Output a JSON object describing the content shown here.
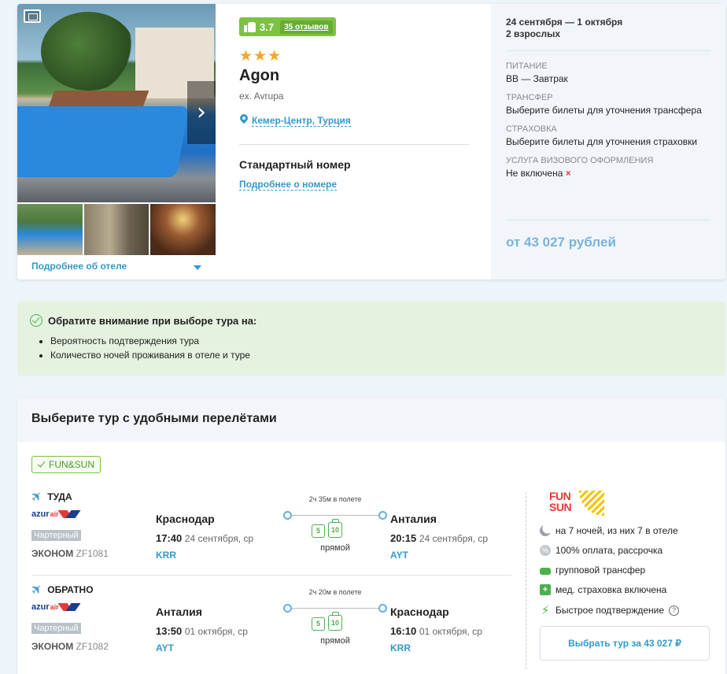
{
  "hotel": {
    "rating": "3.7",
    "reviews": "35 отзывов",
    "stars": "★★★",
    "name": "Agon",
    "ex_name": "ex. Avrupa",
    "location": "Кемер-Центр, Турция",
    "room": "Стандартный номер",
    "room_more": "Подробнее о номере",
    "hotel_more": "Подробнее об отеле"
  },
  "side": {
    "dates": "24 сентября — 1 октября",
    "guests": "2 взрослых",
    "meals_label": "ПИТАНИЕ",
    "meals_value": "BB — Завтрак",
    "transfer_label": "ТРАНСФЕР",
    "transfer_value": "Выберите билеты для уточнения трансфера",
    "insurance_label": "СТРАХОВКА",
    "insurance_value": "Выберите билеты для уточнения страховки",
    "visa_label": "УСЛУГА ВИЗОВОГО ОФОРМЛЕНИЯ",
    "visa_value": "Не включена",
    "visa_mark": "×",
    "price": "от 43 027 рублей"
  },
  "notice": {
    "title": "Обратите внимание при выборе тура на:",
    "items": [
      "Вероятность подтверждения тура",
      "Количество ночей проживания в отеле и туре"
    ]
  },
  "tours": {
    "title": "Выберите тур с удобными перелётами",
    "operator": "FUN&SUN",
    "outbound": {
      "title": "ТУДА",
      "airline_a": "azur",
      "airline_b": "air",
      "charter": "Чартерный",
      "class": "ЭКОНОМ",
      "flight": "ZF1081",
      "from_city": "Краснодар",
      "from_time": "17:40",
      "from_date": "24 сентября, ср",
      "from_code": "KRR",
      "duration": "2ч 35м в полете",
      "bag_hand": "5",
      "bag_main": "10",
      "direct": "прямой",
      "to_city": "Анталия",
      "to_time": "20:15",
      "to_date": "24 сентября, ср",
      "to_code": "AYT"
    },
    "return": {
      "title": "ОБРАТНО",
      "airline_a": "azur",
      "airline_b": "air",
      "charter": "Чартерный",
      "class": "ЭКОНОМ",
      "flight": "ZF1082",
      "from_city": "Анталия",
      "from_time": "13:50",
      "from_date": "01 октября, ср",
      "from_code": "AYT",
      "duration": "2ч 20м в полете",
      "bag_hand": "5",
      "bag_main": "10",
      "direct": "прямой",
      "to_city": "Краснодар",
      "to_time": "16:10",
      "to_date": "01 октября, ср",
      "to_code": "KRR"
    },
    "panel": {
      "logo_line1": "FUN",
      "logo_line2": "SUN",
      "nights": "на 7 ночей, из них 7 в отеле",
      "payment": "100% оплата, рассрочка",
      "transfer": "групповой трансфер",
      "insurance": "мед. страховка включена",
      "confirm": "Быстрое подтверждение",
      "help": "?",
      "button": "Выбрать тур за 43 027 ₽"
    }
  },
  "icons": {
    "next": "›",
    "plane": "✈",
    "bolt": "⚡",
    "plus": "+",
    "percent": "%"
  },
  "colors": {
    "accent": "#3399cc",
    "rating_green": "#7dc242",
    "star": "#f5a623",
    "notice_bg": "#e4f2df",
    "price": "#7bb3d9",
    "brand_red": "#e53935"
  }
}
